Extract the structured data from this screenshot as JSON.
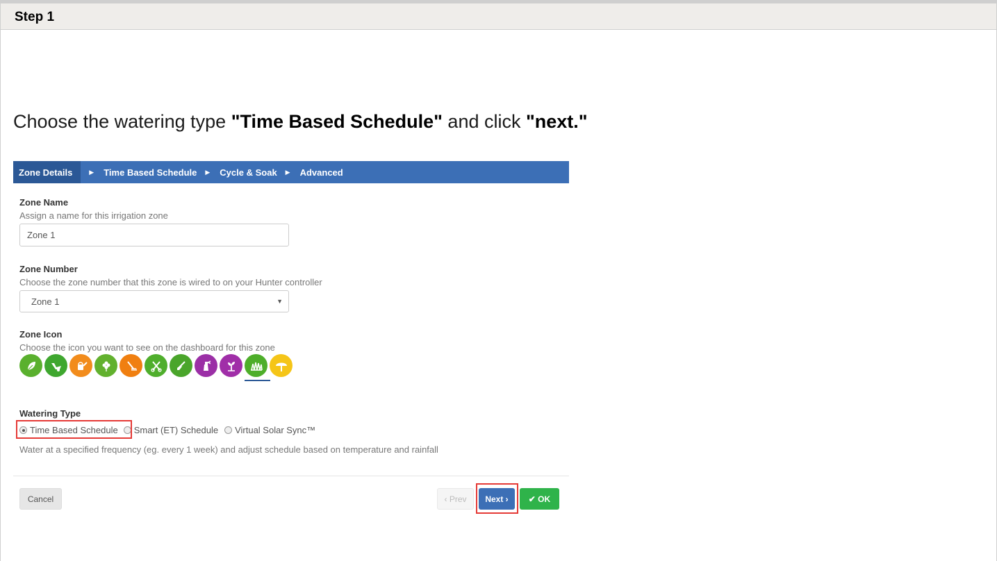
{
  "step": {
    "title": "Step 1"
  },
  "instruction": {
    "prefix": "Choose the watering type ",
    "bold1": "\"Time Based Schedule\"",
    "middle": " and click ",
    "bold2": "\"next.\""
  },
  "wizard": {
    "steps": [
      {
        "label": "Zone Details",
        "active": true
      },
      {
        "label": "Time Based Schedule",
        "active": false
      },
      {
        "label": "Cycle & Soak",
        "active": false
      },
      {
        "label": "Advanced",
        "active": false
      }
    ],
    "separator": "▶"
  },
  "zone_name": {
    "label": "Zone Name",
    "help": "Assign a name for this irrigation zone",
    "value": "Zone 1"
  },
  "zone_number": {
    "label": "Zone Number",
    "help": "Choose the zone number that this zone is wired to on your Hunter controller",
    "value": "Zone 1",
    "arrow": "▼"
  },
  "zone_icon": {
    "label": "Zone Icon",
    "help": "Choose the icon you want to see on the dashboard for this zone",
    "icons": [
      {
        "name": "leaf-icon",
        "color": "#5ab02e"
      },
      {
        "name": "wheelbarrow-icon",
        "color": "#3fa72f"
      },
      {
        "name": "watering-can-icon",
        "color": "#f28c1c"
      },
      {
        "name": "flower-icon",
        "color": "#62b12e"
      },
      {
        "name": "rake-icon",
        "color": "#f07f10"
      },
      {
        "name": "pruning-shears-icon",
        "color": "#4fae2c"
      },
      {
        "name": "shovel-icon",
        "color": "#4aa52b"
      },
      {
        "name": "sprayer-icon",
        "color": "#9b2fa6"
      },
      {
        "name": "seedling-icon",
        "color": "#a02ea8"
      },
      {
        "name": "grass-icon",
        "color": "#4eae2a",
        "selected": true
      },
      {
        "name": "tree-icon",
        "color": "#f5c518"
      }
    ]
  },
  "watering_type": {
    "label": "Watering Type",
    "options": [
      {
        "label": "Time Based Schedule",
        "checked": true
      },
      {
        "label": "Smart (ET) Schedule",
        "checked": false
      },
      {
        "label": "Virtual Solar Sync™",
        "checked": false
      }
    ],
    "help": "Water at a specified frequency (eg. every 1 week) and adjust schedule based on temperature and rainfall"
  },
  "buttons": {
    "cancel": "Cancel",
    "prev": "‹ Prev",
    "next": "Next ›",
    "ok": "✔ OK"
  },
  "colors": {
    "nav_blue": "#3c6fb6",
    "nav_active": "#2b5896",
    "ok_green": "#2fb34a",
    "highlight_red": "#e53935"
  }
}
